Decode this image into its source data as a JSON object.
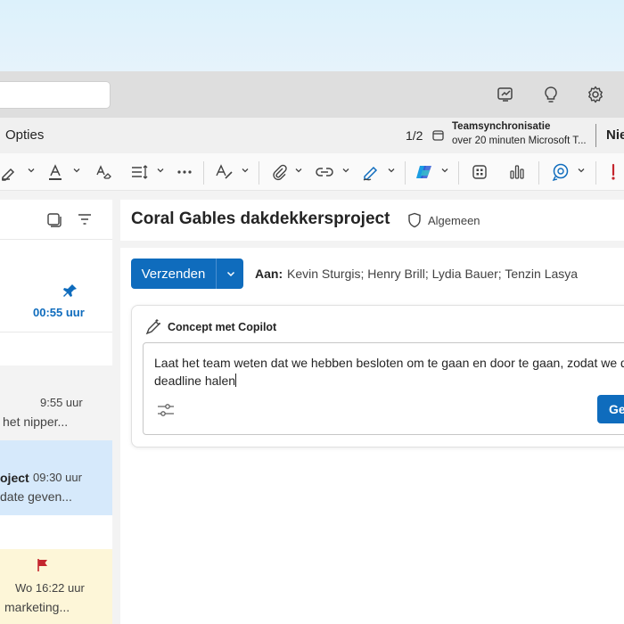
{
  "options": {
    "label": "Opties",
    "pager": "1/2",
    "sync_title": "Teamsynchronisatie",
    "sync_subtitle": "over 20 minuten Microsoft T...",
    "new_label": "Nie"
  },
  "mail_list": {
    "items": [
      {
        "time": "00:55 uur",
        "pinned": true
      },
      {
        "time": "9:55 uur",
        "preview": "het nipper..."
      },
      {
        "subject": "oject",
        "time": "09:30 uur",
        "preview": "date geven...",
        "selected": true
      },
      {
        "time": "Wo 16:22 uur",
        "preview": "marketing...",
        "flagged": true
      }
    ]
  },
  "message": {
    "subject": "Coral Gables dakdekkersproject",
    "sensitivity": "Algemeen",
    "send_label": "Verzenden",
    "to_label": "Aan:",
    "to_recipients": "Kevin Sturgis; Henry Brill; Lydia Bauer; Tenzin Lasya"
  },
  "copilot": {
    "title": "Concept met Copilot",
    "prompt": "Laat het team weten dat we hebben besloten om te gaan en door te gaan, zodat we de deadline halen",
    "generate_label": "Ge"
  },
  "colors": {
    "accent": "#0f6cbd",
    "selected_row": "#d6e9fb",
    "flagged_row": "#fdf6d8",
    "flag_red": "#c4262e"
  }
}
